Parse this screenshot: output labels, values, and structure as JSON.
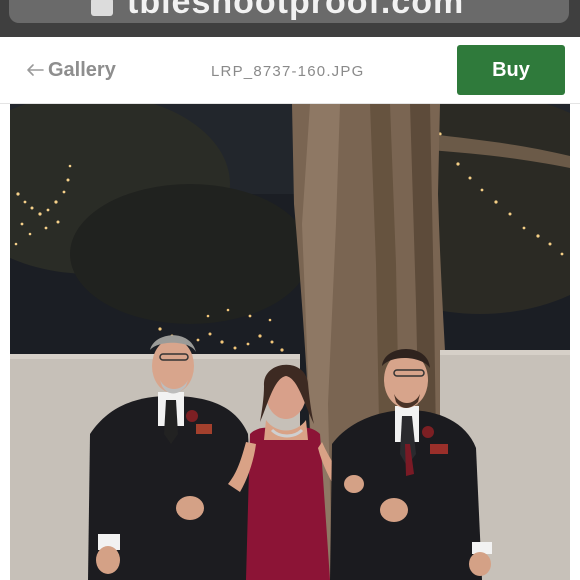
{
  "browser": {
    "url_text": "tbleshootproof.com",
    "lock_icon": "lock-icon"
  },
  "header": {
    "back_label": "Gallery",
    "back_icon": "arrow-left-icon",
    "filename": "LRP_8737-160.JPG",
    "buy_label": "Buy",
    "buy_color": "#2f7a3b"
  },
  "photo": {
    "subject": "wedding-party-photo"
  }
}
